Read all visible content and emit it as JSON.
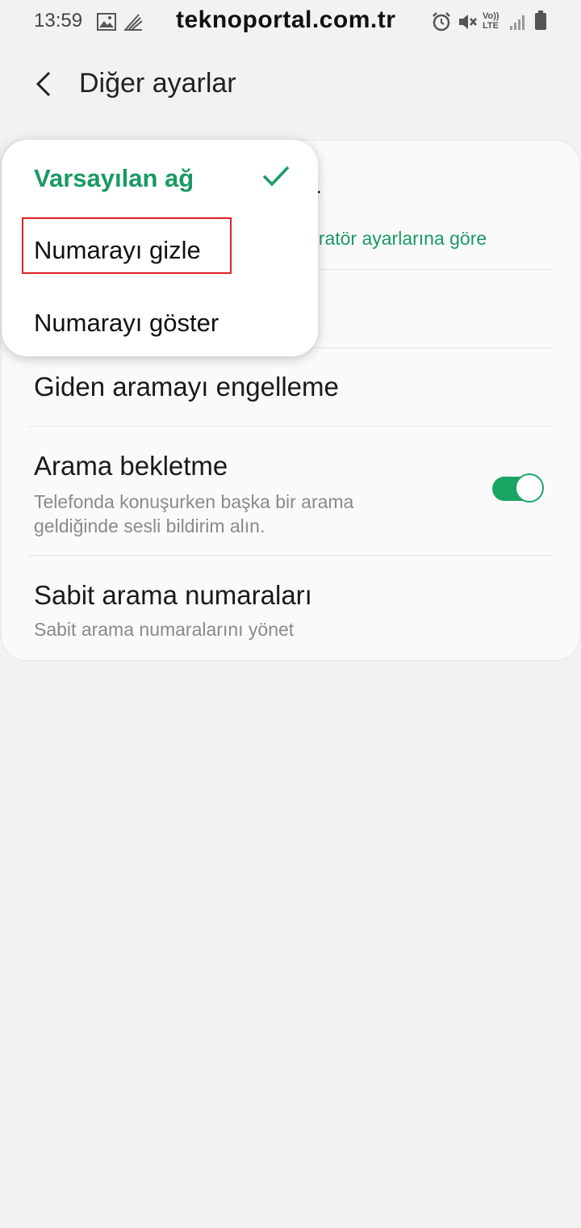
{
  "status_bar": {
    "time": "13:59",
    "watermark": "teknoportal.com.tr",
    "icons": [
      "image-icon",
      "sync-icon",
      "alarm-icon",
      "mute-icon",
      "volte-icon",
      "signal-icon",
      "battery-icon"
    ],
    "volte_label_top": "Vo))",
    "volte_label_bottom": "LTE"
  },
  "header": {
    "title": "Diğer ayarlar"
  },
  "settings": {
    "caller_id_sub_partial": "eratör ayarlarına göre",
    "outgoing_barring": "Giden aramayı engelleme",
    "call_waiting": {
      "title": "Arama bekletme",
      "subtitle_line1": "Telefonda konuşurken başka bir arama",
      "subtitle_line2": "geldiğinde sesli bildirim alın.",
      "enabled": true
    },
    "fixed_dialing": {
      "title": "Sabit arama numaraları",
      "subtitle": "Sabit arama numaralarını yönet"
    }
  },
  "popup_menu": {
    "items": [
      {
        "label": "Varsayılan ağ",
        "selected": true
      },
      {
        "label": "Numarayı gizle",
        "selected": false,
        "highlighted": true
      },
      {
        "label": "Numarayı göster",
        "selected": false
      }
    ]
  },
  "colors": {
    "accent_green": "#1a9a62",
    "highlight_red": "#e02020",
    "background": "#f2f2f2"
  }
}
